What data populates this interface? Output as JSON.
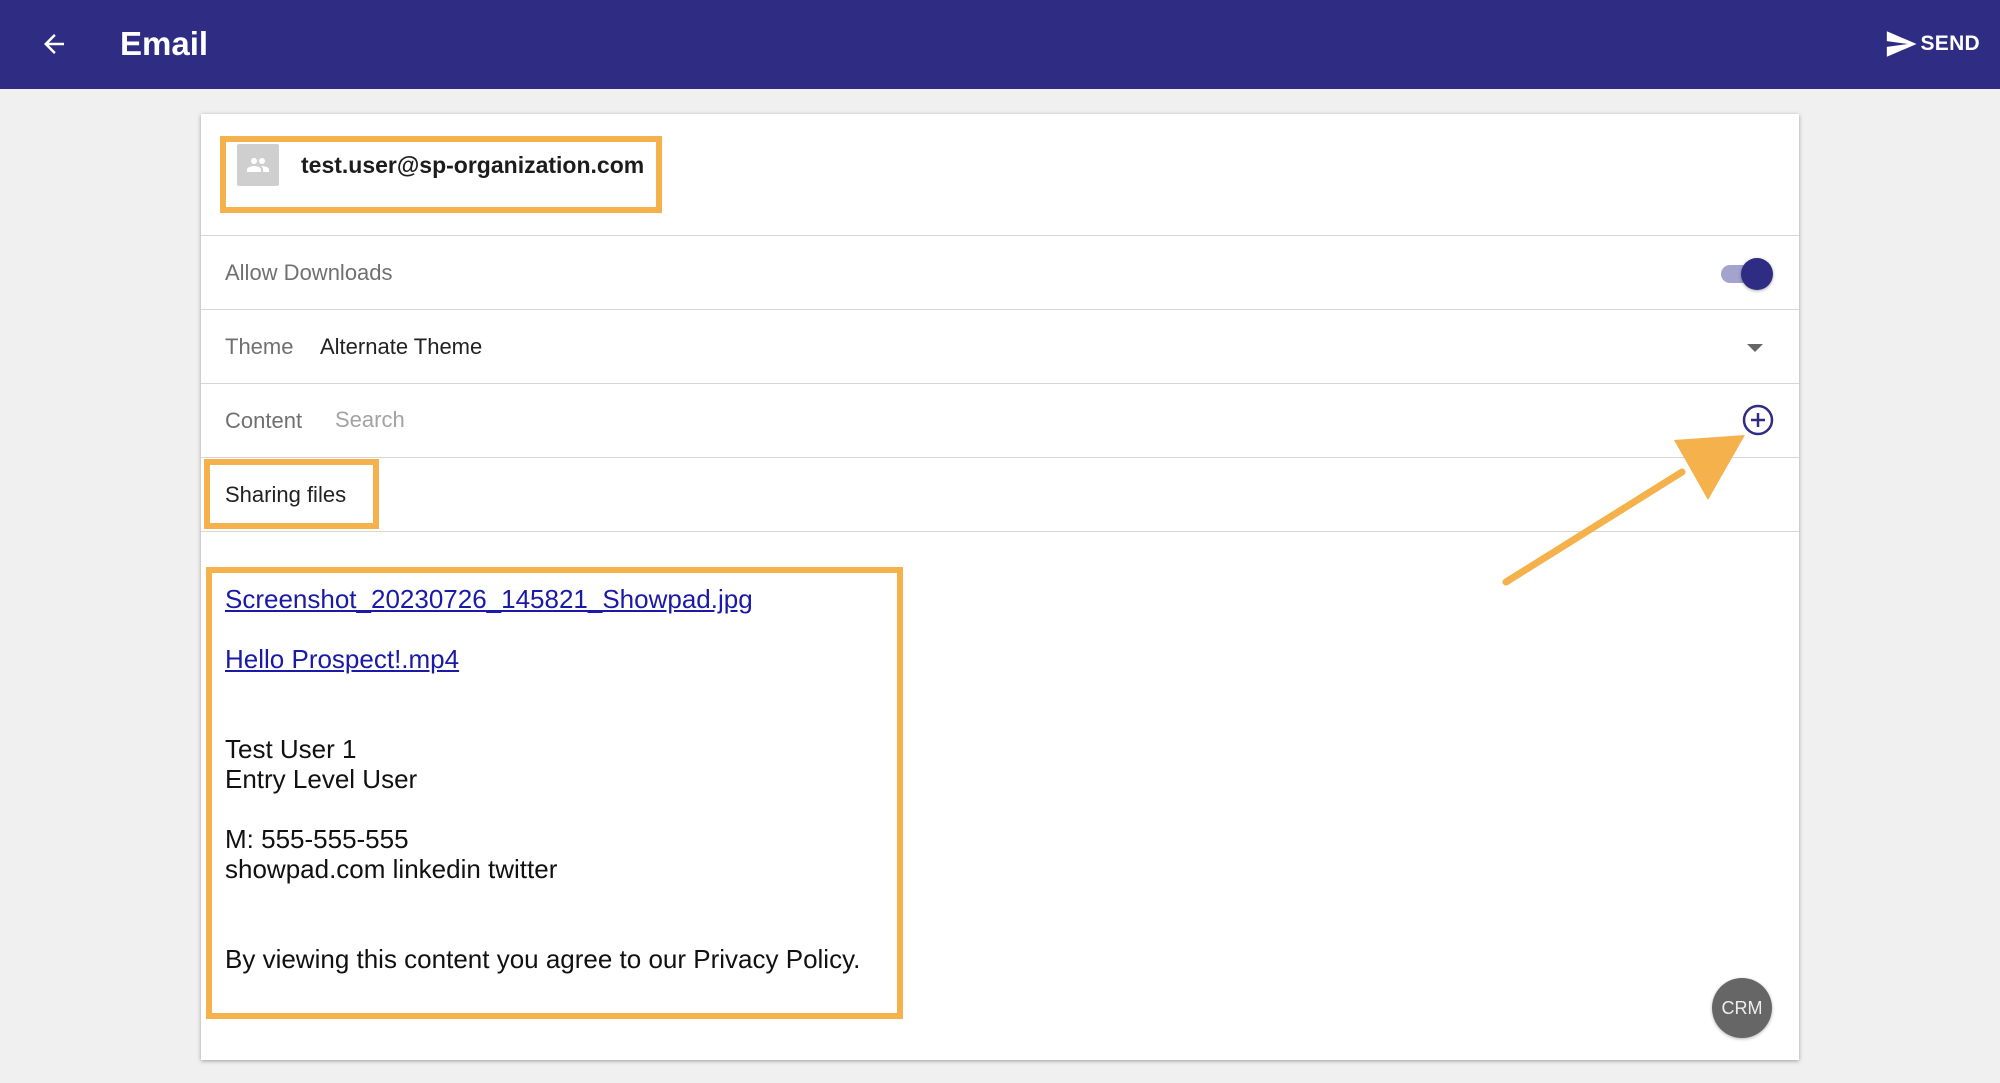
{
  "appbar": {
    "title": "Email",
    "send_label": "SEND",
    "back_icon": "arrow-left-icon",
    "send_icon": "send-icon",
    "color": "#2e2d83"
  },
  "recipient": {
    "email": "test.user@sp-organization.com",
    "avatar_icon": "group-icon"
  },
  "downloads": {
    "label": "Allow Downloads",
    "enabled": true
  },
  "theme": {
    "label": "Theme",
    "value": "Alternate Theme"
  },
  "content": {
    "label": "Content",
    "search_placeholder": "Search",
    "add_icon": "add-circle-icon"
  },
  "sharing": {
    "label": "Sharing files"
  },
  "body": {
    "files": [
      "Screenshot_20230726_145821_Showpad.jpg",
      "Hello Prospect!.mp4"
    ],
    "signature_name": "Test User 1",
    "signature_title": "Entry Level User",
    "signature_phone": "M: 555-555-555",
    "signature_links": "showpad.com linkedin twitter",
    "disclaimer": "By viewing this content you agree to our Privacy Policy."
  },
  "crm": {
    "label": "CRM"
  },
  "annotations": {
    "highlight_color": "#f5b14c"
  }
}
